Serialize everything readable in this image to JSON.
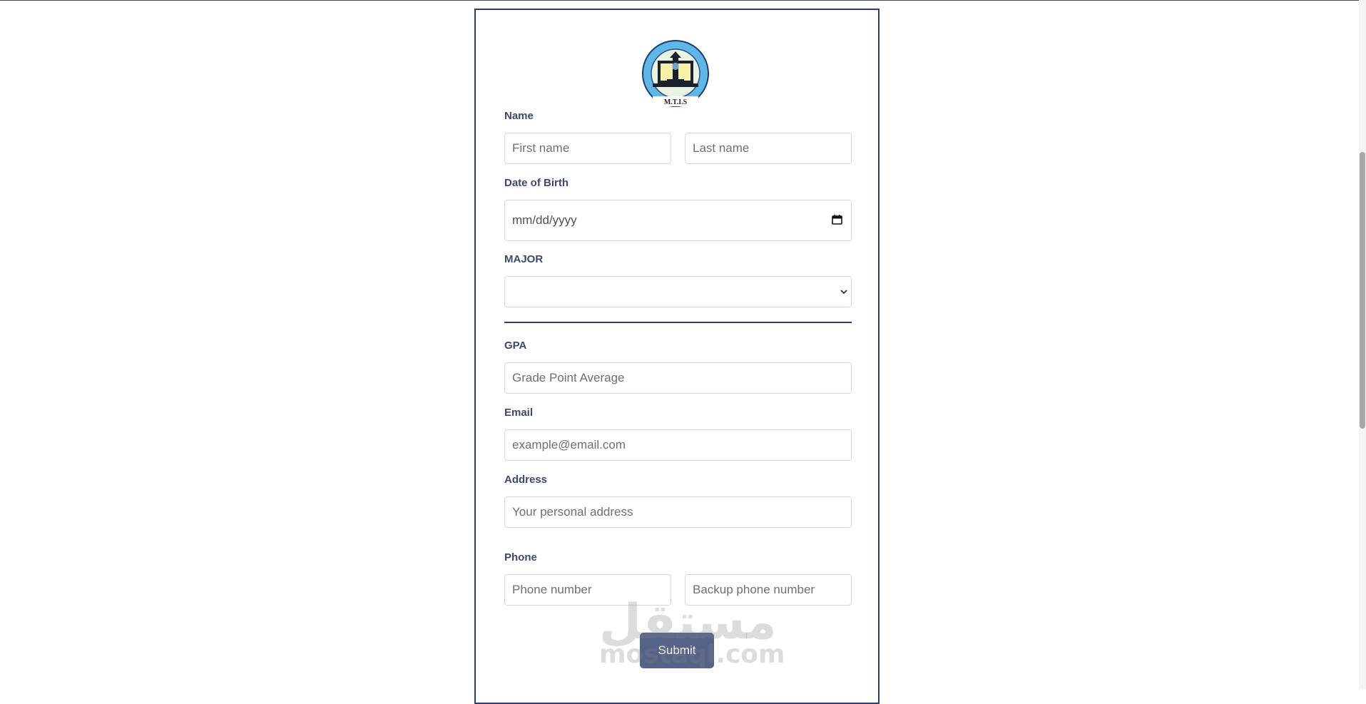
{
  "form": {
    "name_label": "Name",
    "first_name_placeholder": "First name",
    "last_name_placeholder": "Last name",
    "dob_label": "Date of Birth",
    "dob_value": "mm/dd/yyyy",
    "major_label": "MAJOR",
    "major_selected": "",
    "gpa_label": "GPA",
    "gpa_placeholder": "Grade Point Average",
    "email_label": "Email",
    "email_placeholder": "example@email.com",
    "address_label": "Address",
    "address_placeholder": "Your personal address",
    "phone_label": "Phone",
    "phone_placeholder": "Phone number",
    "backup_phone_placeholder": "Backup phone number",
    "submit_label": "Submit"
  },
  "logo": {
    "caption": "M.T.I.S",
    "icon": "university-seal-icon"
  },
  "watermark": {
    "arabic": "مستقل",
    "latin": "mostaql.com"
  },
  "colors": {
    "border": "#2b3f76",
    "label": "#3b4a6b",
    "button": "#556389",
    "logo_blue": "#5fb7e6"
  }
}
